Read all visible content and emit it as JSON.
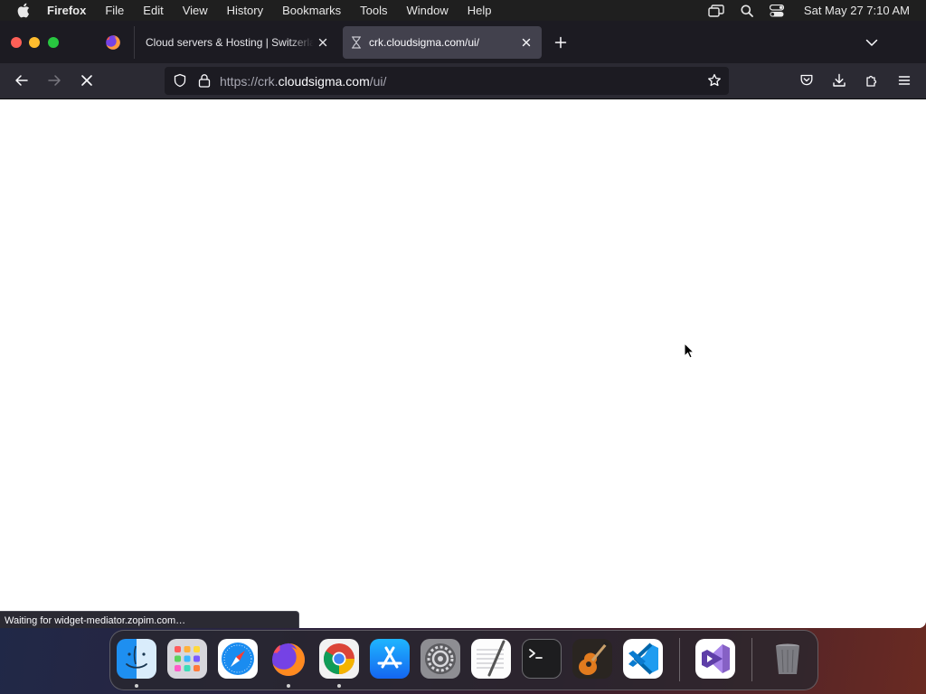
{
  "menubar": {
    "app_name": "Firefox",
    "items": [
      "File",
      "Edit",
      "View",
      "History",
      "Bookmarks",
      "Tools",
      "Window",
      "Help"
    ],
    "clock": "Sat May 27  7:10 AM",
    "icons": [
      "apple-icon",
      "screen-mirroring-icon",
      "spotlight-search-icon",
      "control-center-icon"
    ]
  },
  "tabs": [
    {
      "title": "Cloud servers & Hosting | Switzerland",
      "active": false
    },
    {
      "title": "crk.cloudsigma.com/ui/",
      "active": true,
      "loading": true
    }
  ],
  "navbar": {
    "url_prefix": "https://crk.",
    "url_domain": "cloudsigma.com",
    "url_path": "/ui/"
  },
  "status_text": "Waiting for widget-mediator.zopim.com…",
  "dock": {
    "apps": [
      {
        "name": "Finder",
        "running": true
      },
      {
        "name": "Launchpad",
        "running": false
      },
      {
        "name": "Safari",
        "running": false
      },
      {
        "name": "Firefox",
        "running": true
      },
      {
        "name": "Google Chrome",
        "running": true
      },
      {
        "name": "App Store",
        "running": false
      },
      {
        "name": "System Preferences",
        "running": false
      },
      {
        "name": "TextEdit",
        "running": false
      },
      {
        "name": "Terminal",
        "running": false
      },
      {
        "name": "GarageBand",
        "running": false
      },
      {
        "name": "Visual Studio Code",
        "running": false
      },
      {
        "name": "Visual Studio",
        "running": false
      },
      {
        "name": "Trash",
        "running": false
      }
    ]
  },
  "colors": {
    "tabbar_bg": "#1c1b22",
    "toolbar_bg": "#2b2a33",
    "active_tab_bg": "#42414d",
    "menubar_bg": "#1f1f1f"
  }
}
